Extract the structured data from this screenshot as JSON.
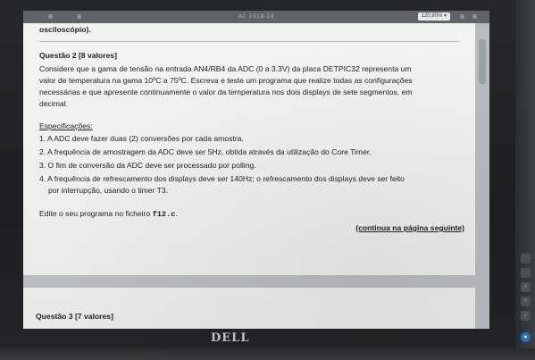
{
  "viewer": {
    "title": "AC 2018-19",
    "zoom": "120,90%"
  },
  "document": {
    "prev_line": "osciloscópio).",
    "question2": {
      "heading": "Questão 2 [8 valores]",
      "paragraph_lines": [
        "Considere que a gama de tensão na entrada AN4/RB4 da ADC (0 a 3.3V) da placa DETPIC32 representa um",
        "valor de temperatura na gama 10ºC a 75ºC. Escreva e teste um programa que realize todas as configurações",
        "necessárias e que apresente continuamente o valor da temperatura nos dois displays de sete segmentos, em",
        "decimal."
      ],
      "spec_label": "Especificações:",
      "specs": [
        {
          "text": "1. A ADC deve fazer duas (2) conversões por cada amostra.",
          "cont": ""
        },
        {
          "text": "2. A frequência de amostragem da ADC deve ser 5Hz, obtida através da utilização do Core Timer.",
          "cont": ""
        },
        {
          "text": "3. O fim de conversão da ADC deve ser processado por polling.",
          "cont": ""
        },
        {
          "text": "4. A frequência de refrescamento dos displays deve ser 140Hz; o refrescamento dos displays deve ser feito",
          "cont": "por interrupção, usando o timer T3."
        }
      ],
      "edit_prefix": "Edite o seu programa no ficheiro ",
      "edit_file": "f12.c",
      "edit_suffix": ".",
      "continue": "(continua na página seguinte)"
    },
    "question3": {
      "heading": "Questão 3 [7 valores]"
    }
  },
  "monitor": {
    "brand": "DELL"
  }
}
